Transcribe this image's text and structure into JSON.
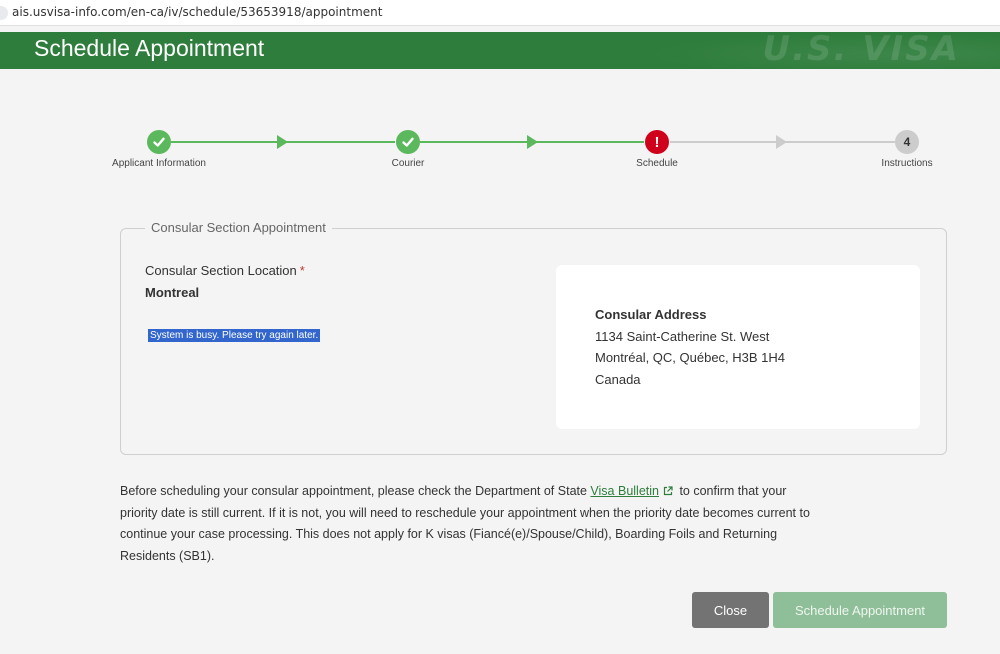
{
  "browser": {
    "url": "ais.usvisa-info.com/en-ca/iv/schedule/53653918/appointment"
  },
  "header": {
    "title": "Schedule Appointment",
    "watermark": "U.S. VISA"
  },
  "stepper": {
    "steps": [
      {
        "label": "Applicant Information",
        "status": "complete",
        "icon": "check-icon"
      },
      {
        "label": "Courier",
        "status": "complete",
        "icon": "check-icon"
      },
      {
        "label": "Schedule",
        "status": "error",
        "icon": "exclamation-icon",
        "glyph": "!"
      },
      {
        "label": "Instructions",
        "status": "pending",
        "number": "4"
      }
    ]
  },
  "panel": {
    "legend": "Consular Section Appointment",
    "location_label": "Consular Section Location",
    "required_mark": "*",
    "location_value": "Montreal",
    "busy_message": "System is busy. Please try again later."
  },
  "address": {
    "title": "Consular Address",
    "line1": "1134 Saint-Catherine St. West",
    "line2": "Montréal, QC, Québec, H3B 1H4",
    "line3": "Canada"
  },
  "notice": {
    "before": "Before scheduling your consular appointment, please check the Department of State ",
    "link": "Visa Bulletin",
    "after": " to confirm that your priority date is still current. If it is not, you will need to reschedule your appointment when the priority date becomes current to continue your case processing. This does not apply for K visas (Fiancé(e)/Spouse/Child), Boarding Foils and Returning Residents (SB1)."
  },
  "buttons": {
    "close": "Close",
    "schedule": "Schedule Appointment"
  },
  "colors": {
    "brand_green": "#2e7d3c",
    "step_green": "#5cb85c",
    "error_red": "#d0021b",
    "pending_gray": "#cccccc"
  }
}
